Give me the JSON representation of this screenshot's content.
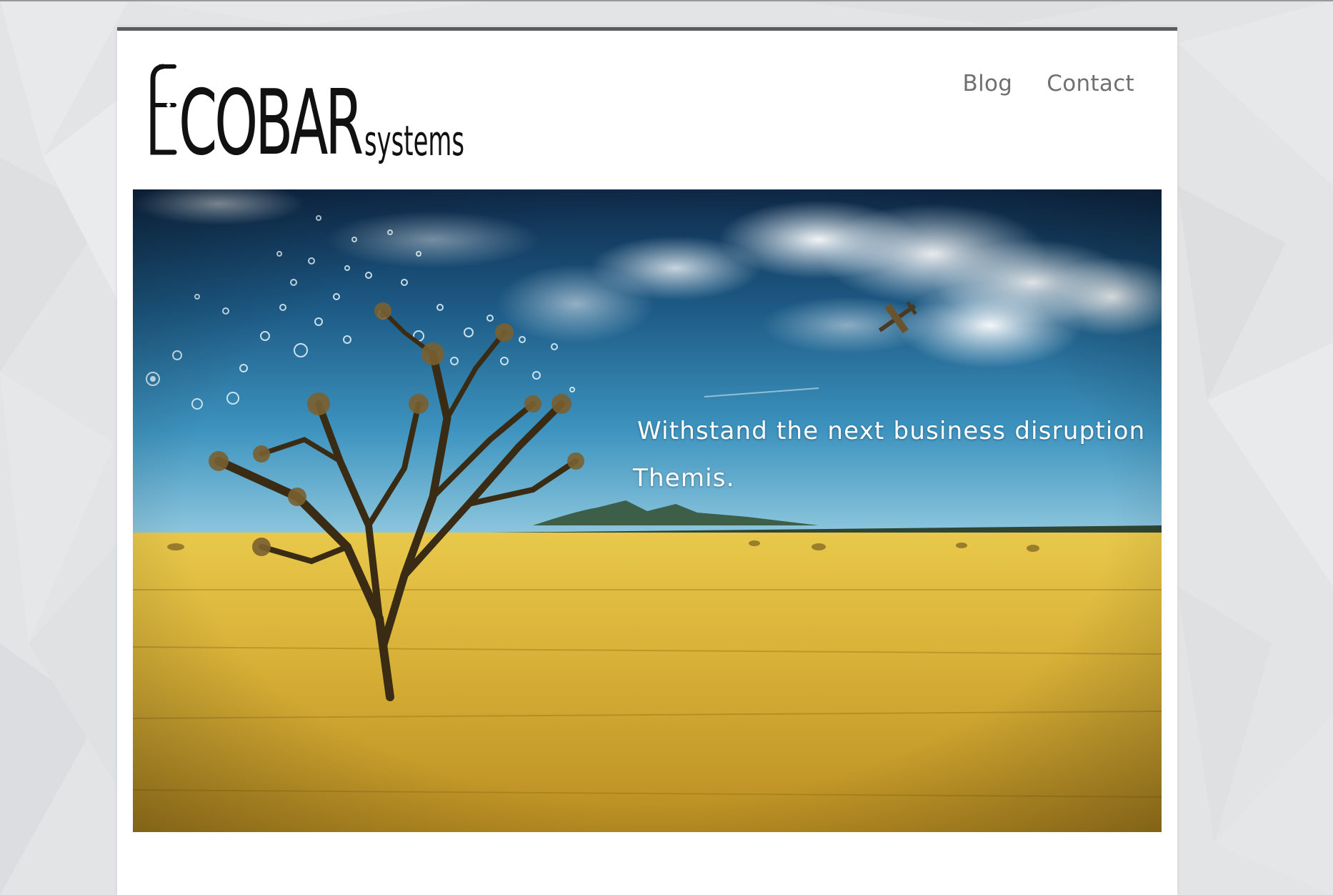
{
  "header": {
    "logo": {
      "main_text": "COBAR",
      "sub_text": "systems"
    },
    "nav": [
      {
        "label": "Blog"
      },
      {
        "label": "Contact"
      }
    ]
  },
  "hero": {
    "headline": "Withstand the next business disruption",
    "subline": "Themis."
  },
  "colors": {
    "page_background": "#e3e4e6",
    "card_background": "#ffffff",
    "card_top_border": "#5c5c5c",
    "nav_text": "#707070",
    "hero_text": "#ffffff"
  }
}
